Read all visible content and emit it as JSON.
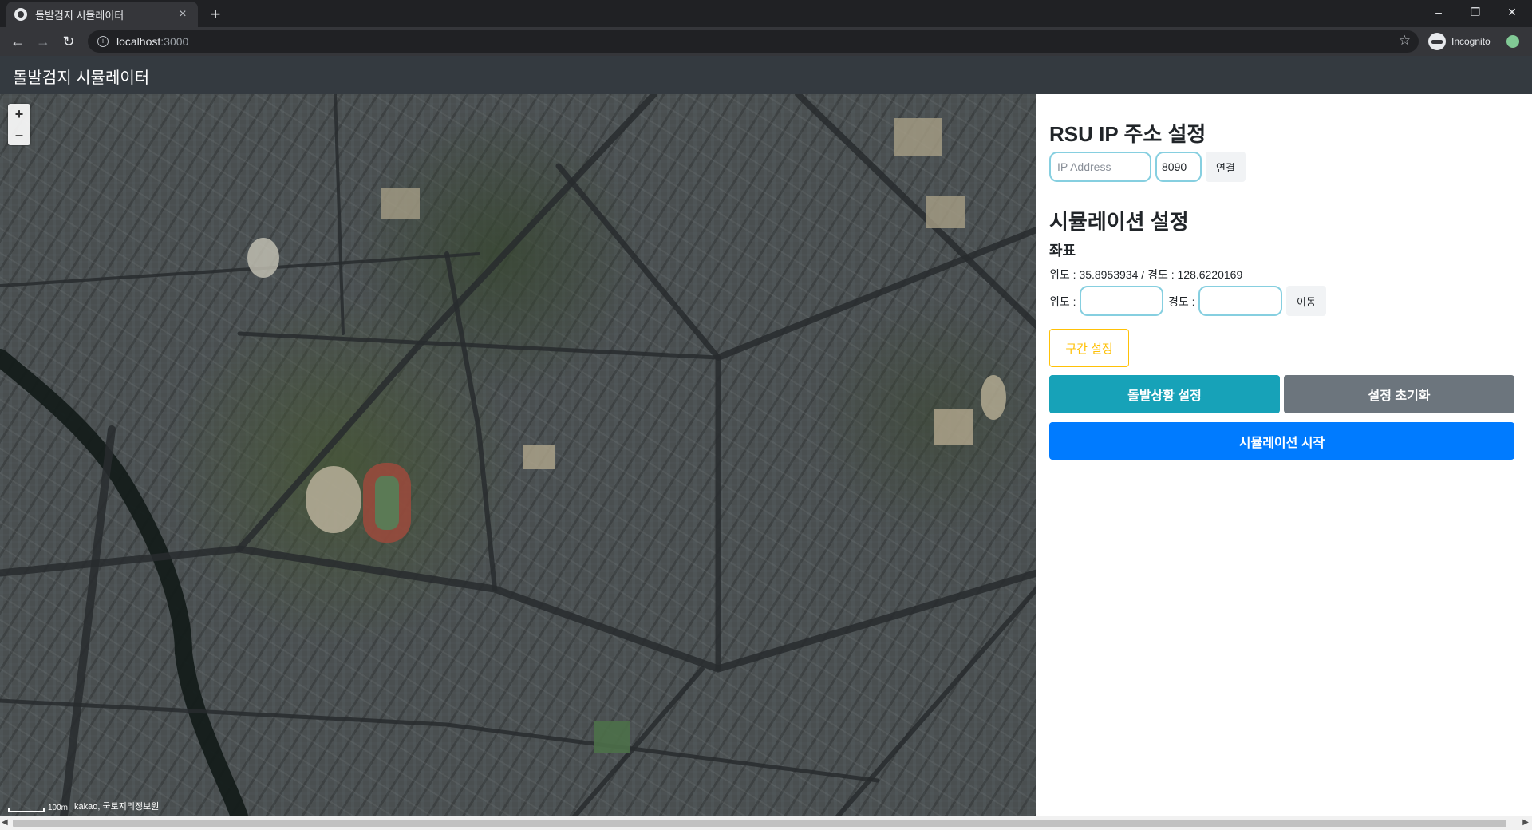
{
  "browser": {
    "tab_title": "돌발검지 시뮬레이터",
    "tab_close": "×",
    "new_tab": "+",
    "url_host": "localhost",
    "url_port": ":3000",
    "profile_label": "Incognito",
    "controls": {
      "minimize": "–",
      "maximize": "❐",
      "close": "✕"
    },
    "nav": {
      "back": "←",
      "forward": "→",
      "reload": "↻"
    },
    "star": "☆",
    "info": "i"
  },
  "app": {
    "brand": "돌발검지 시뮬레이터"
  },
  "map": {
    "zoom_in": "+",
    "zoom_out": "–",
    "scale_label": "100m",
    "attribution": "kakao, 국토지리정보원"
  },
  "rsu": {
    "heading": "RSU IP 주소 설정",
    "ip_placeholder": "IP Address",
    "port_value": "8090",
    "connect_label": "연결"
  },
  "simulation": {
    "heading": "시뮬레이션 설정",
    "coord_heading": "좌표",
    "coord_readout": "위도 : 35.8953934 / 경도 : 128.6220169",
    "lat_label": "위도 :",
    "lng_label": "경도 :",
    "move_label": "이동",
    "section_label": "구간 설정",
    "incident_label": "돌발상황 설정",
    "reset_label": "설정 초기화",
    "start_label": "시뮬레이션 시작"
  },
  "colors": {
    "navbar": "#343a40",
    "info_button": "#17a2b8",
    "secondary_button": "#6c757d",
    "primary_button": "#007bff",
    "warning_outline": "#ffc107",
    "input_focus_border": "#86cfe0"
  }
}
